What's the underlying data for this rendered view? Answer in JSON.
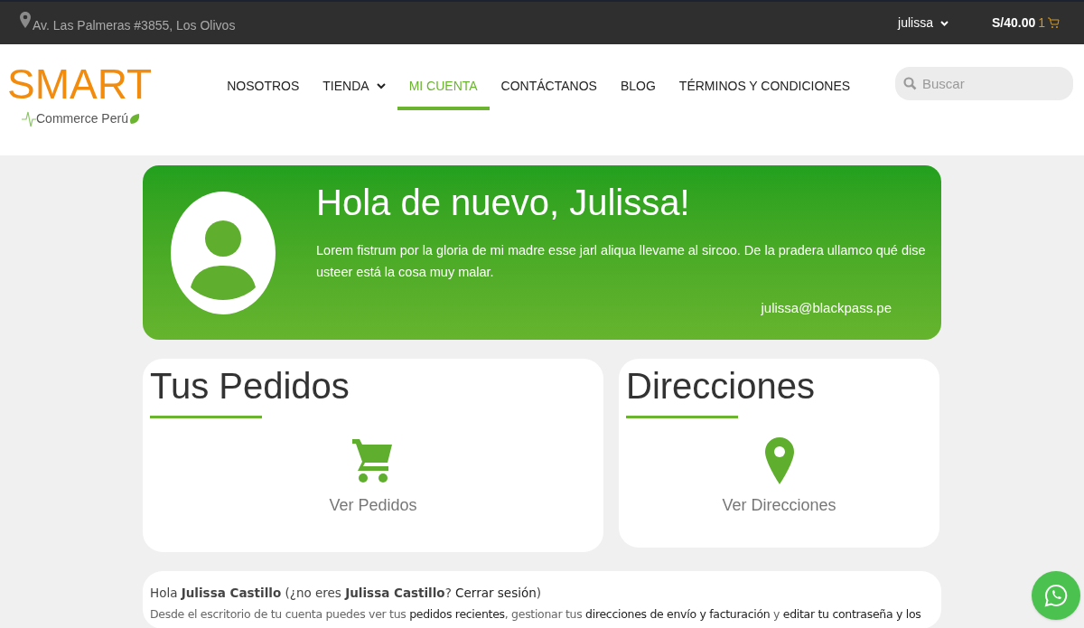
{
  "topbar": {
    "address": "Av. Las Palmeras #3855, Los Olivos",
    "user": "julissa",
    "cart_total": "S/40.00",
    "cart_count": "1"
  },
  "logo": {
    "title": "SMART",
    "subtitle": "Commerce Perú"
  },
  "nav": [
    {
      "label": "NOSOTROS",
      "selected": false,
      "dropdown": false
    },
    {
      "label": "TIENDA",
      "selected": false,
      "dropdown": true
    },
    {
      "label": "MI CUENTA",
      "selected": true,
      "dropdown": false
    },
    {
      "label": "CONTÁCTANOS",
      "selected": false,
      "dropdown": false
    },
    {
      "label": "BLOG",
      "selected": false,
      "dropdown": false
    },
    {
      "label": "TÉRMINOS Y CONDICIONES",
      "selected": false,
      "dropdown": false
    }
  ],
  "search": {
    "placeholder": "Buscar"
  },
  "hero": {
    "title": "Hola de nuevo, Julissa!",
    "text": "Lorem fistrum por la gloria de mi madre esse jarl aliqua llevame al sircoo. De la pradera ullamco qué dise usteer está la cosa muy malar.",
    "email": "julissa@blackpass.pe"
  },
  "cards": [
    {
      "title": "Tus Pedidos",
      "link": "Ver Pedidos",
      "kind": "orders"
    },
    {
      "title": "Direcciones",
      "link": "Ver Direcciones",
      "kind": "addresses"
    }
  ],
  "welcome": {
    "line_1": [
      {
        "text": "Hola **Julissa Castillo** (¿no eres **Julissa Castillo**? ",
        "link": false
      },
      {
        "text": "Cerrar sesión",
        "link": true
      },
      {
        "text": ")",
        "link": false
      }
    ],
    "line_2": [
      {
        "text": "Desde el escritorio de tu cuenta puedes ver tus ",
        "link": false
      },
      {
        "text": "pedidos recientes",
        "link": true
      },
      {
        "text": ", gestionar tus ",
        "link": false
      },
      {
        "text": "direcciones de envío y facturación",
        "link": true
      },
      {
        "text": " y ",
        "link": false
      },
      {
        "text": "editar tu contraseña y los",
        "link": true
      }
    ]
  }
}
